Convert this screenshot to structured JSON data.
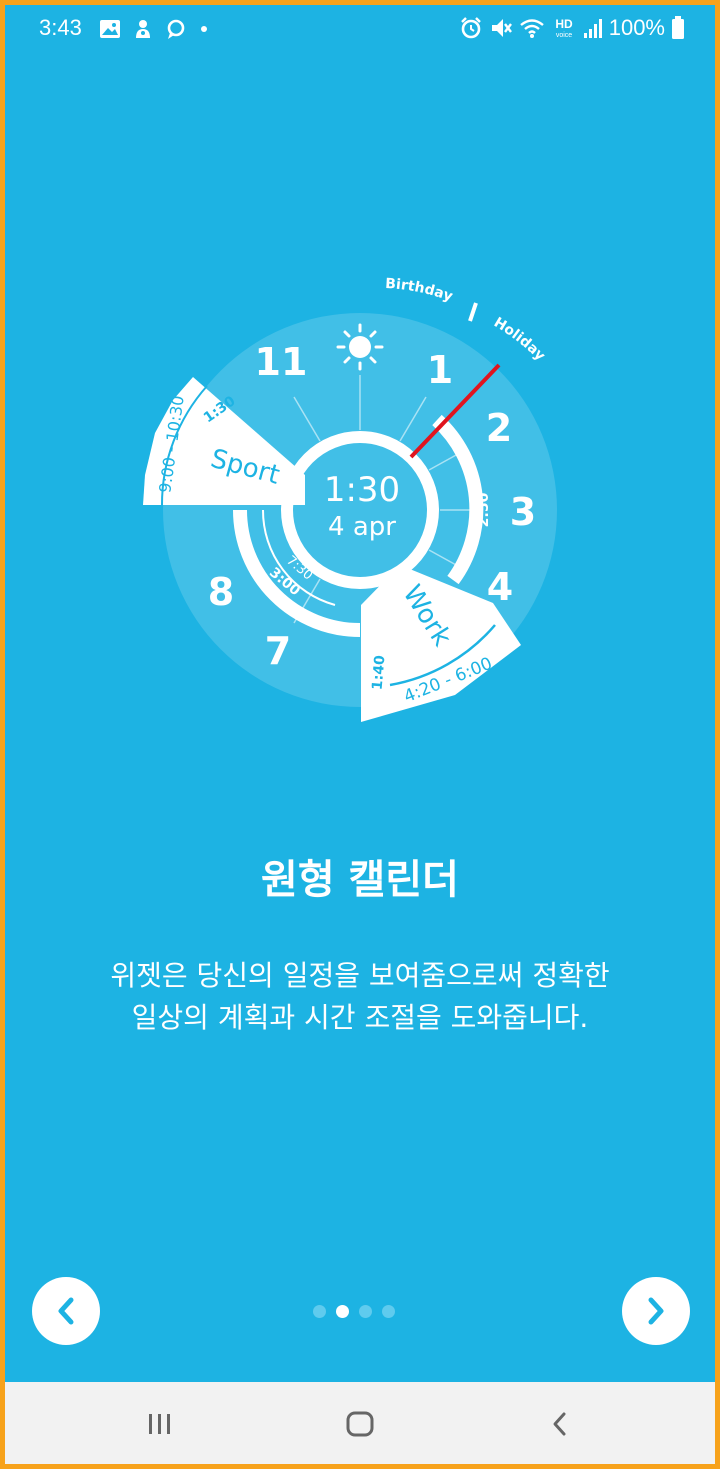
{
  "status_bar": {
    "time": "3:43",
    "battery": "100%",
    "left_icons": [
      "gallery-icon",
      "notification-icon",
      "chat-icon",
      "dot-icon"
    ],
    "right_icons": [
      "alarm-icon",
      "mute-icon",
      "wifi-icon",
      "hd-voice-icon",
      "signal-icon",
      "battery-icon"
    ],
    "hd_label": "HD",
    "voice_label": "voice"
  },
  "widget": {
    "center_time": "1:30",
    "center_date": "4 apr",
    "hours": [
      "11",
      "1",
      "2",
      "3",
      "4",
      "7",
      "8"
    ],
    "sun_icon": "sun-icon",
    "top_labels": {
      "birthday": "Birthday",
      "holiday": "Holiday"
    },
    "events": {
      "sport": {
        "label": "Sport",
        "range": "9:00 - 10:30",
        "duration": "1:30"
      },
      "work": {
        "label": "Work",
        "range": "4:20 - 6:00",
        "duration": "1:40"
      },
      "ring_right": "2:50",
      "ring_left_a": "3:00",
      "ring_left_b": "7:30"
    }
  },
  "content": {
    "title": "원형 캘린더",
    "description_line1": "위젯은 당신의 일정을 보여줌으로써 정확한",
    "description_line2": "일상의 계획과 시간 조절을 도와줍니다."
  },
  "pager": {
    "count": 4,
    "active_index": 1
  },
  "colors": {
    "background": "#1DB3E3",
    "accent": "#E0141E",
    "frame": "#F7A21B"
  }
}
